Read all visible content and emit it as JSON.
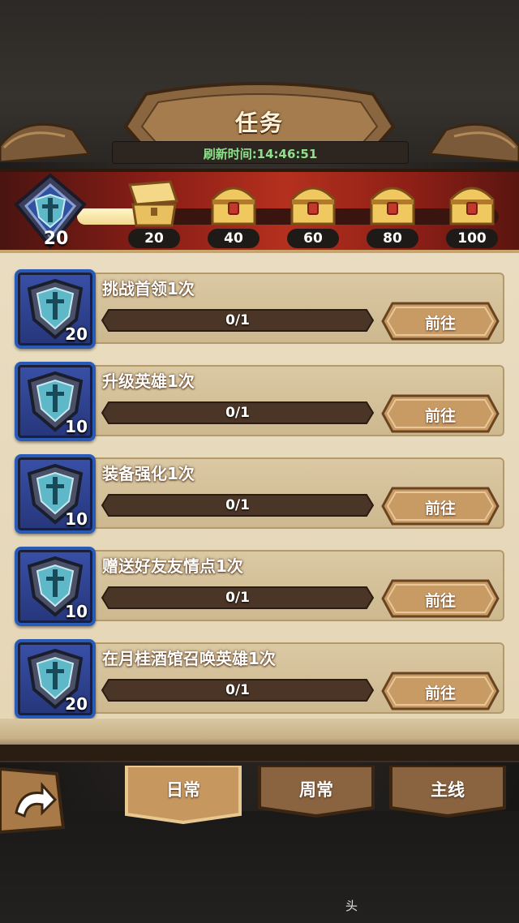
{
  "header": {
    "title": "任务",
    "refresh_label": "刷新时间:14:46:51"
  },
  "rewards": {
    "current_points": "20",
    "progress_fraction": 0.2,
    "milestones": [
      {
        "label": "20",
        "state": "opened"
      },
      {
        "label": "40",
        "state": "locked"
      },
      {
        "label": "60",
        "state": "locked"
      },
      {
        "label": "80",
        "state": "locked"
      },
      {
        "label": "100",
        "state": "locked"
      }
    ]
  },
  "tasks": [
    {
      "title": "挑战首领1次",
      "reward": "20",
      "progress": "0/1",
      "button": "前往"
    },
    {
      "title": "升级英雄1次",
      "reward": "10",
      "progress": "0/1",
      "button": "前往"
    },
    {
      "title": "装备强化1次",
      "reward": "10",
      "progress": "0/1",
      "button": "前往"
    },
    {
      "title": "赠送好友友情点1次",
      "reward": "10",
      "progress": "0/1",
      "button": "前往"
    },
    {
      "title": "在月桂酒馆召唤英雄1次",
      "reward": "20",
      "progress": "0/1",
      "button": "前往"
    }
  ],
  "tabs": [
    {
      "label": "日常",
      "active": true
    },
    {
      "label": "周常",
      "active": false
    },
    {
      "label": "主线",
      "active": false
    }
  ],
  "watermark": "头",
  "colors": {
    "band_red": "#b5301e",
    "shield_blue": "#3950a8",
    "parchment": "#e9dcc0",
    "refresh_green": "#8ee08c"
  }
}
